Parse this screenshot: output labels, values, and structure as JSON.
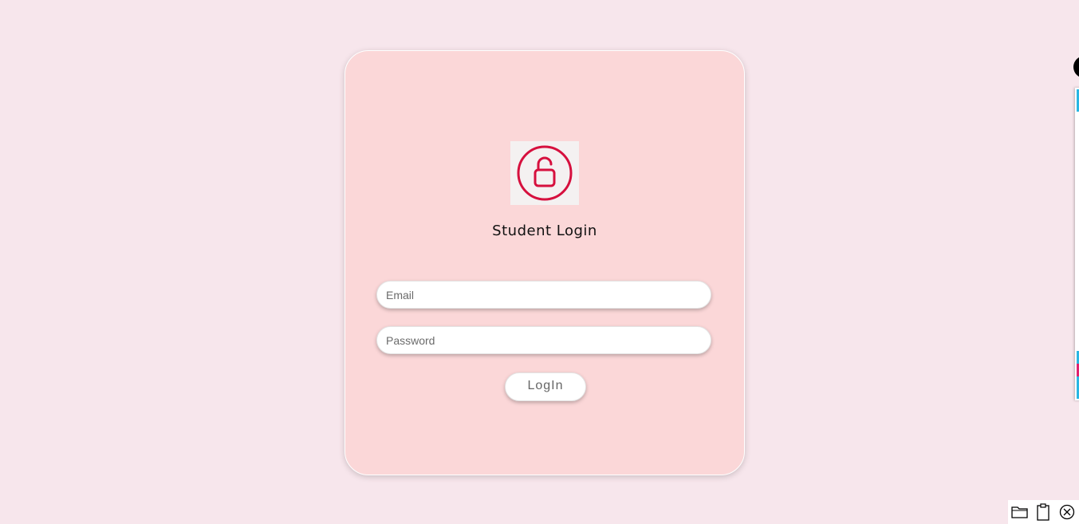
{
  "login": {
    "title": "Student Login",
    "email_placeholder": "Email",
    "password_placeholder": "Password",
    "button_label": "LogIn"
  },
  "icons": {
    "logo": "unlock-icon",
    "toolbar": [
      "folder-icon",
      "clipboard-icon",
      "close-circle-icon"
    ]
  },
  "colors": {
    "background": "#f7e6ec",
    "card": "#fbd7d8",
    "accent": "#d6103e"
  }
}
